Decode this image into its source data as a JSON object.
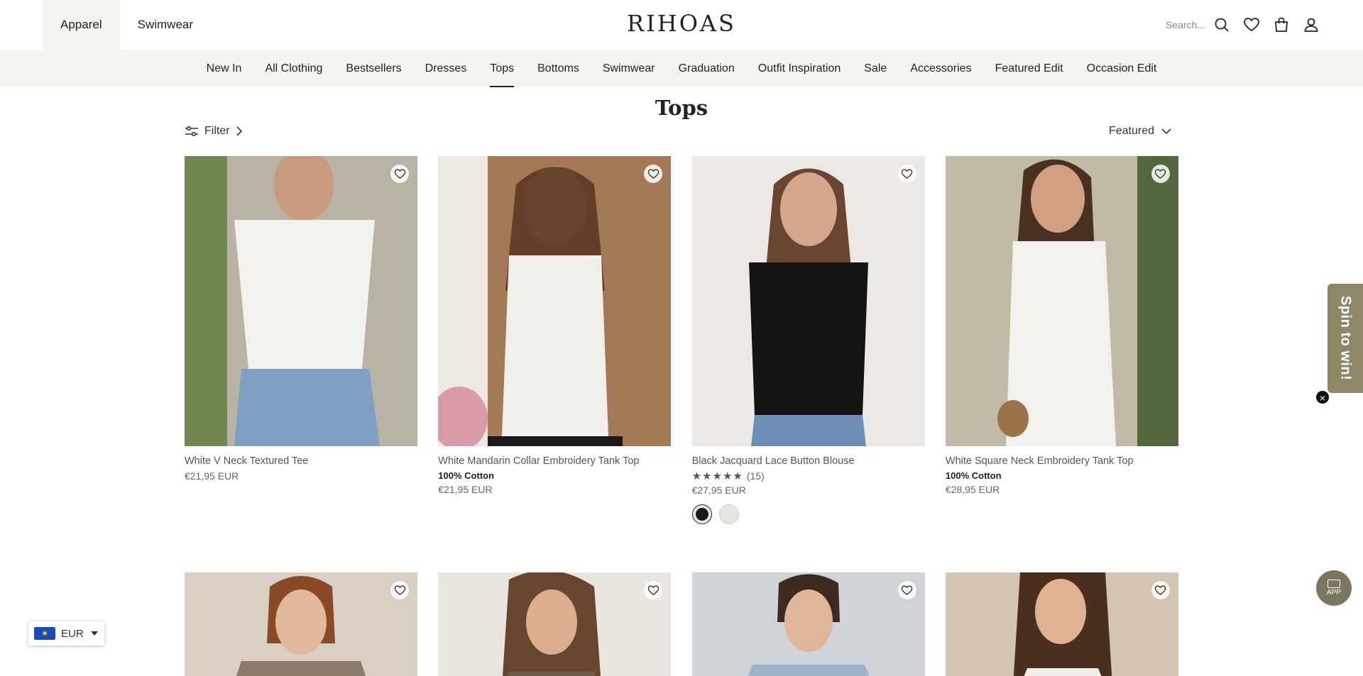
{
  "header": {
    "store_tabs": [
      {
        "label": "Apparel",
        "active": true
      },
      {
        "label": "Swimwear",
        "active": false
      }
    ],
    "logo": "RIHOAS",
    "search_placeholder": "Search...",
    "icons": [
      "search-icon",
      "heart-icon",
      "bag-icon",
      "user-icon"
    ]
  },
  "nav": {
    "items": [
      {
        "label": "New In"
      },
      {
        "label": "All Clothing"
      },
      {
        "label": "Bestsellers"
      },
      {
        "label": "Dresses"
      },
      {
        "label": "Tops",
        "active": true
      },
      {
        "label": "Bottoms"
      },
      {
        "label": "Swimwear"
      },
      {
        "label": "Graduation"
      },
      {
        "label": "Outfit Inspiration"
      },
      {
        "label": "Sale"
      },
      {
        "label": "Accessories"
      },
      {
        "label": "Featured Edit"
      },
      {
        "label": "Occasion Edit"
      }
    ]
  },
  "page": {
    "title": "Tops",
    "filter_label": "Filter",
    "sort_label": "Featured"
  },
  "products": [
    {
      "name": "White V Neck Textured Tee",
      "badge": "",
      "price": "€21,95 EUR",
      "bg": "#b9b3a6",
      "garment": "#f2f1ee"
    },
    {
      "name": "White Mandarin Collar Embroidery Tank Top",
      "badge": "100% Cotton",
      "price": "€21,95 EUR",
      "bg": "#a47a56",
      "garment": "#f0efec"
    },
    {
      "name": "Black Jacquard Lace Button Blouse",
      "badge": "",
      "rating": 5,
      "reviews": "(15)",
      "price": "€27,95 EUR",
      "bg": "#ece8e4",
      "garment": "#141414",
      "swatches": [
        "#1a1a1a",
        "#e8e5de"
      ]
    },
    {
      "name": "White Square Neck Embroidery Tank Top",
      "badge": "100% Cotton",
      "price": "€28,95 EUR",
      "bg": "#c2baa9",
      "garment": "#f3f1ed"
    }
  ],
  "products_row2": [
    {
      "bg": "#d9cfc3",
      "garment": "#8a7b6c"
    },
    {
      "bg": "#e9e5df",
      "garment": "#6e5c4a"
    },
    {
      "bg": "#cfd4d8",
      "garment": "#9fb2c8"
    },
    {
      "bg": "#d3c4b3",
      "garment": "#f1eeea"
    }
  ],
  "floating": {
    "spin_label": "Spin to win!",
    "app_label": "APP",
    "currency": "EUR"
  }
}
